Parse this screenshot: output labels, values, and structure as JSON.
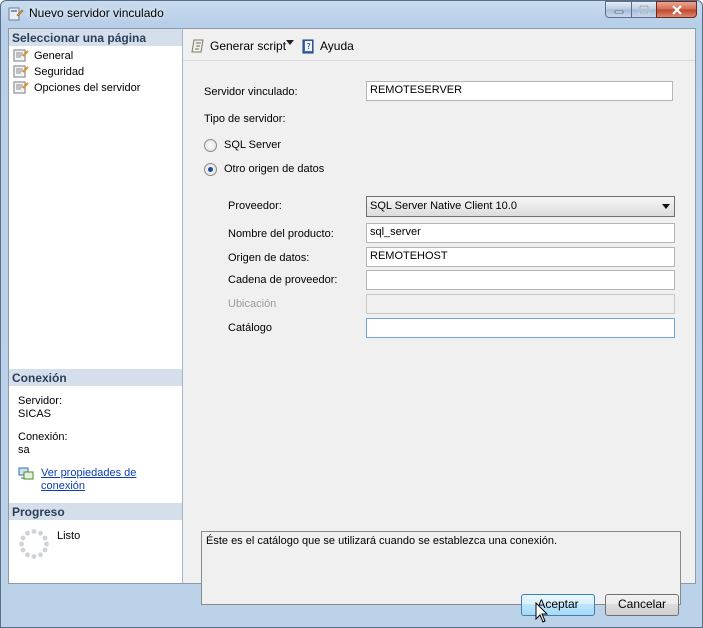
{
  "window": {
    "title": "Nuevo servidor vinculado"
  },
  "sidebar": {
    "header": "Seleccionar una página",
    "items": [
      {
        "label": "General",
        "icon": "page-icon"
      },
      {
        "label": "Seguridad",
        "icon": "page-icon"
      },
      {
        "label": "Opciones del servidor",
        "icon": "page-icon"
      }
    ],
    "connection": {
      "header": "Conexión",
      "server_label": "Servidor:",
      "server_value": "SICAS",
      "connection_label": "Conexión:",
      "connection_value": "sa",
      "link_line1": "Ver propiedades de",
      "link_line2": "conexión"
    },
    "progress": {
      "header": "Progreso",
      "status": "Listo"
    }
  },
  "toolbar": {
    "script_label": "Generar script",
    "help_label": "Ayuda"
  },
  "form": {
    "linked_server_label": "Servidor vinculado:",
    "linked_server_value": "REMOTESERVER",
    "server_type_label": "Tipo de servidor:",
    "radio_sql_server": "SQL Server",
    "radio_other": "Otro origen de datos",
    "selected_server_type": "Otro origen de datos",
    "provider_label": "Proveedor:",
    "provider_value": "SQL Server Native Client 10.0",
    "product_name_label": "Nombre del producto:",
    "product_name_value": "sql_server",
    "data_source_label": "Origen de datos:",
    "data_source_value": "REMOTEHOST",
    "provider_string_label": "Cadena de proveedor:",
    "provider_string_value": "",
    "location_label": "Ubicación",
    "location_value": "",
    "catalog_label": "Catálogo",
    "catalog_value": "",
    "description": "Éste es el catálogo que se utilizará cuando se establezca una conexión."
  },
  "buttons": {
    "ok": "Aceptar",
    "cancel": "Cancelar"
  },
  "colors": {
    "link": "#0b3eb0",
    "section_header_bg": "#d4dfeb",
    "selected_radio": "#1f4c8f"
  }
}
